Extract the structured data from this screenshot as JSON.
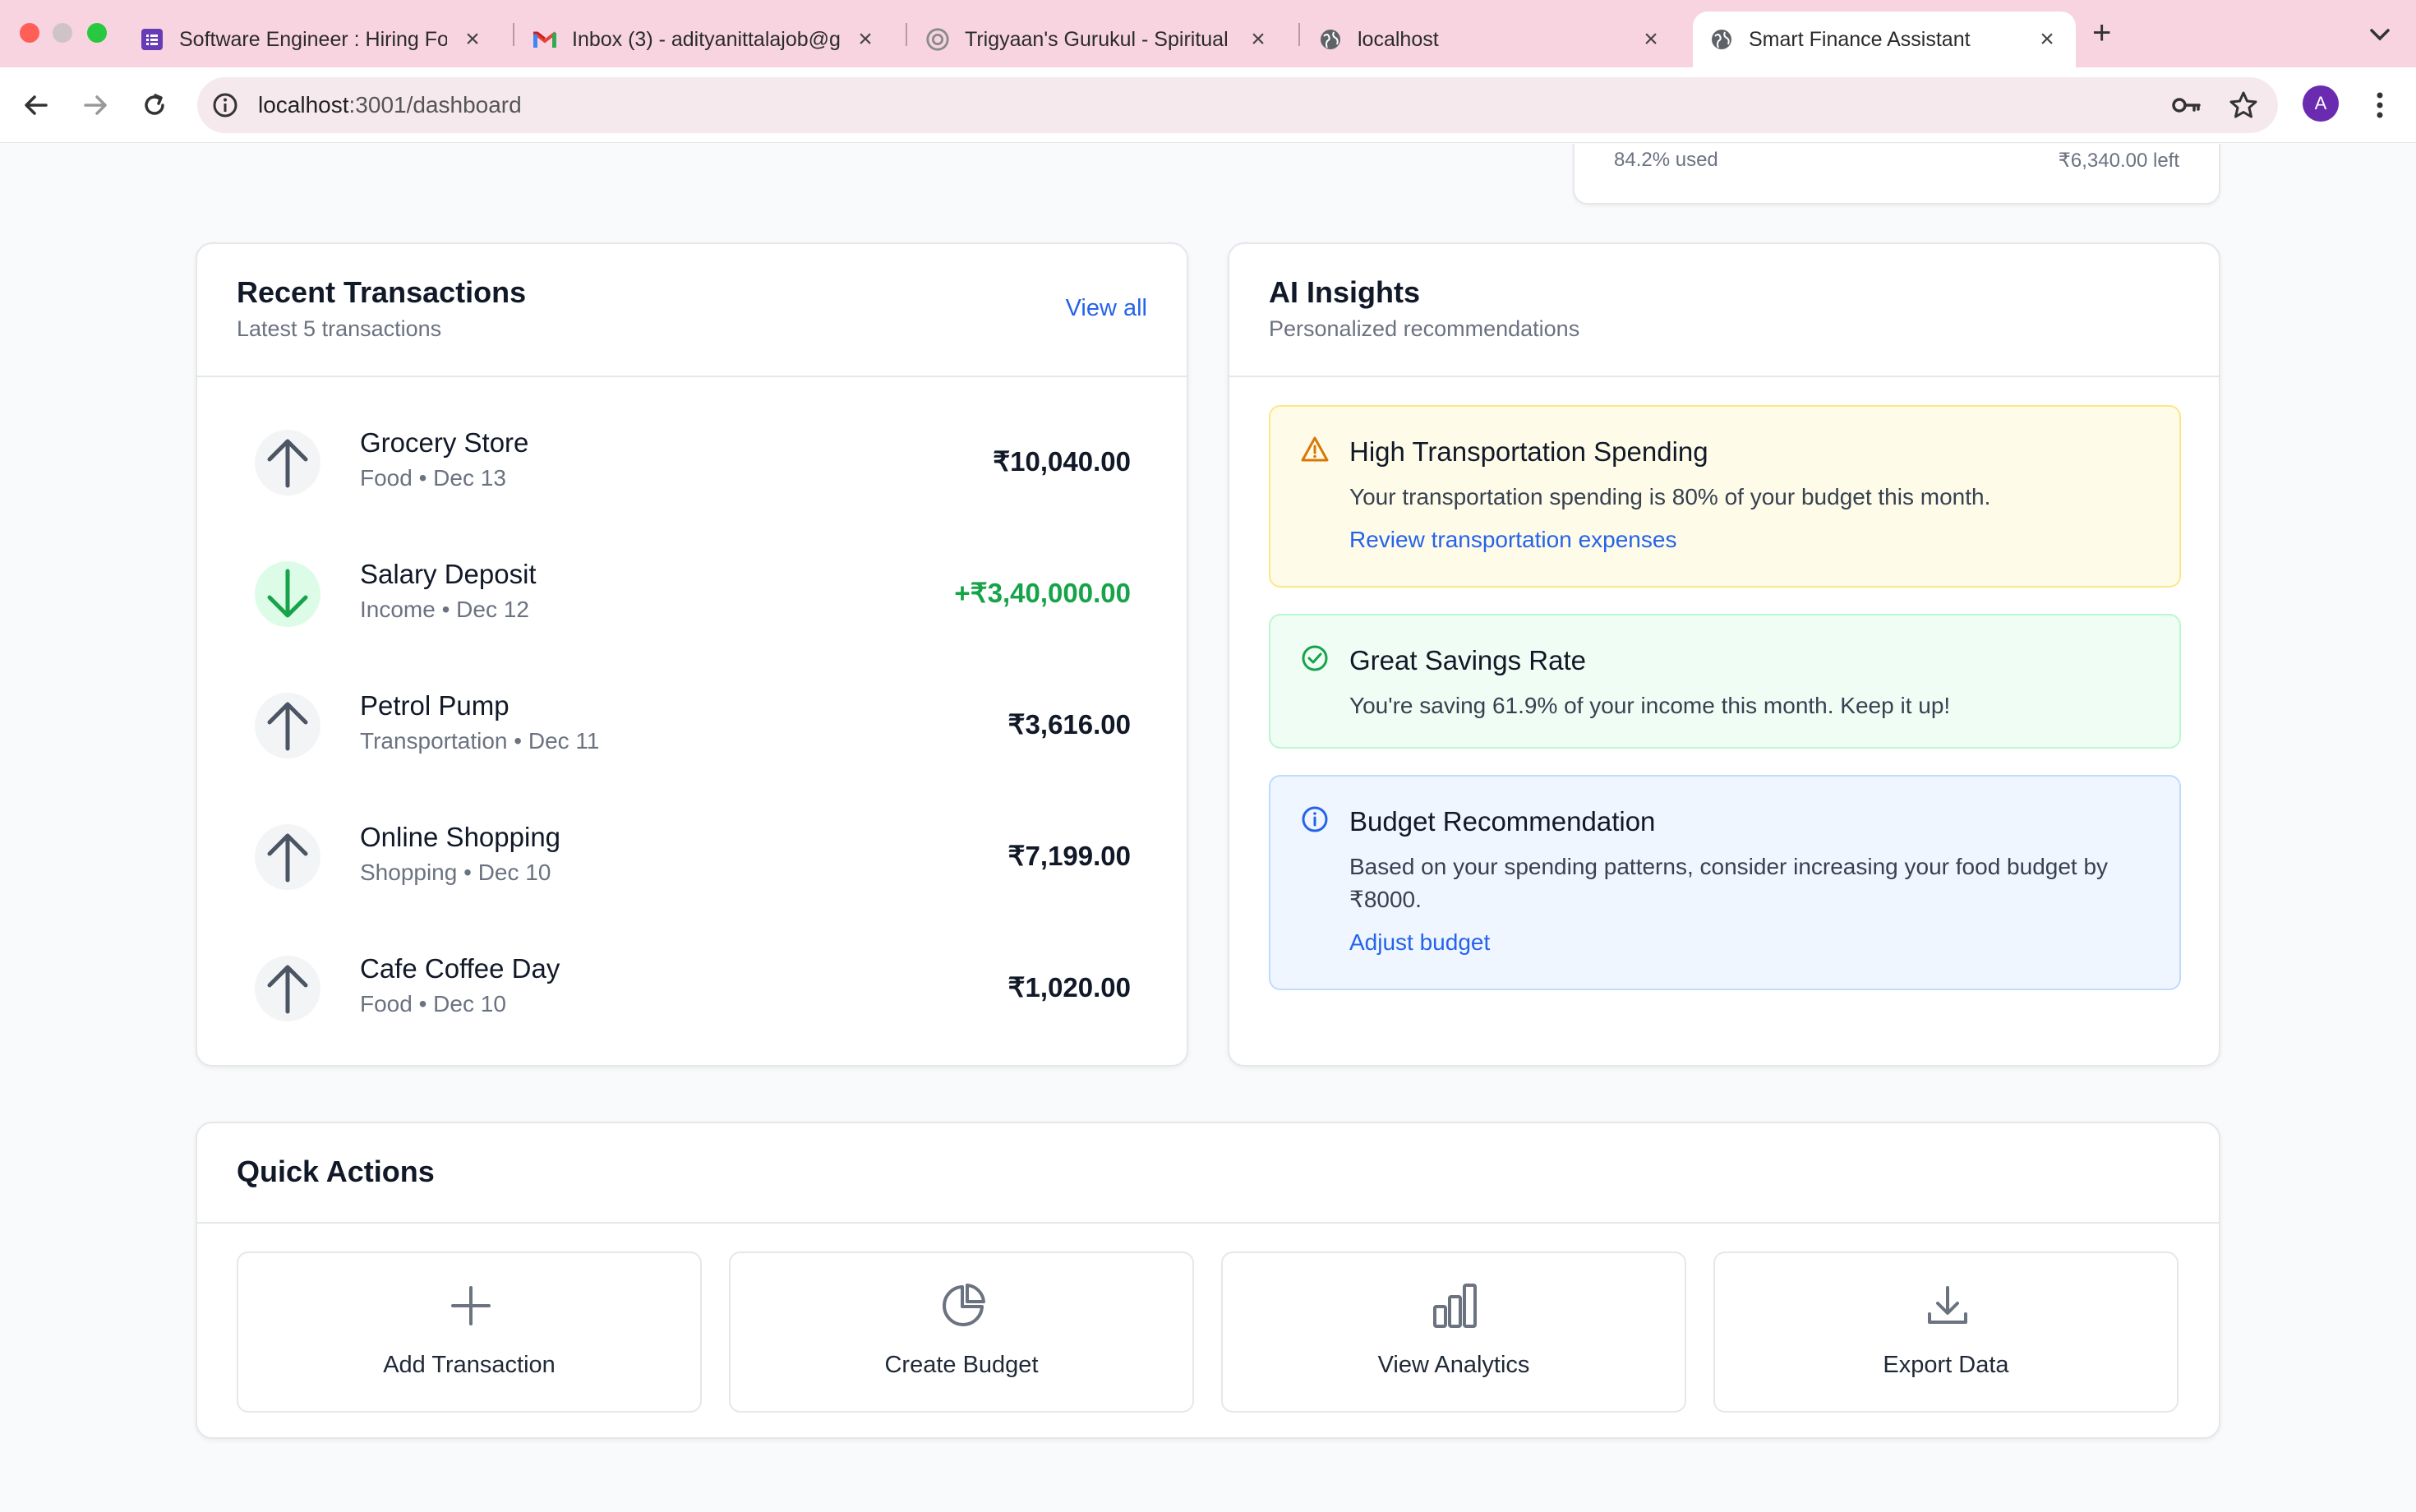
{
  "browser": {
    "tabs": [
      {
        "title": "Software Engineer : Hiring Fo",
        "favicon": "forms-icon",
        "active": false
      },
      {
        "title": "Inbox (3) - adityanittalajob@g",
        "favicon": "gmail-icon",
        "active": false
      },
      {
        "title": "Trigyaan's Gurukul - Spiritual",
        "favicon": "gurukul-icon",
        "active": false
      },
      {
        "title": "localhost",
        "favicon": "globe-icon",
        "active": false
      },
      {
        "title": "Smart Finance Assistant",
        "favicon": "globe-icon",
        "active": true
      }
    ],
    "new_tab_label": "+",
    "url_host": "localhost",
    "url_path": ":3001/dashboard",
    "avatar_initial": "A"
  },
  "budget_remnant": {
    "used_text": "84.2% used",
    "left_text": "₹6,340.00 left"
  },
  "transactions": {
    "title": "Recent Transactions",
    "subtitle": "Latest 5 transactions",
    "view_all": "View all",
    "items": [
      {
        "name": "Grocery Store",
        "meta": "Food • Dec 13",
        "amount": "₹10,040.00",
        "direction": "out"
      },
      {
        "name": "Salary Deposit",
        "meta": "Income • Dec 12",
        "amount": "+₹3,40,000.00",
        "direction": "in"
      },
      {
        "name": "Petrol Pump",
        "meta": "Transportation • Dec 11",
        "amount": "₹3,616.00",
        "direction": "out"
      },
      {
        "name": "Online Shopping",
        "meta": "Shopping • Dec 10",
        "amount": "₹7,199.00",
        "direction": "out"
      },
      {
        "name": "Cafe Coffee Day",
        "meta": "Food • Dec 10",
        "amount": "₹1,020.00",
        "direction": "out"
      }
    ]
  },
  "insights": {
    "title": "AI Insights",
    "subtitle": "Personalized recommendations",
    "items": [
      {
        "title": "High Transportation Spending",
        "body": "Your transportation spending is 80% of your budget this month.",
        "link": "Review transportation expenses",
        "kind": "warning"
      },
      {
        "title": "Great Savings Rate",
        "body": "You're saving 61.9% of your income this month. Keep it up!",
        "link": "",
        "kind": "success"
      },
      {
        "title": "Budget Recommendation",
        "body": "Based on your spending patterns, consider increasing your food budget by ₹8000.",
        "link": "Adjust budget",
        "kind": "info"
      }
    ]
  },
  "quick_actions": {
    "title": "Quick Actions",
    "items": [
      {
        "label": "Add Transaction",
        "icon": "plus-icon"
      },
      {
        "label": "Create Budget",
        "icon": "pie-chart-icon"
      },
      {
        "label": "View Analytics",
        "icon": "bar-chart-icon"
      },
      {
        "label": "Export Data",
        "icon": "download-icon"
      }
    ]
  },
  "colors": {
    "accent": "#2563eb",
    "income": "#16a34a",
    "warning": "#d97706",
    "success": "#16a34a",
    "info": "#2563eb",
    "tab_strip": "#f7d4df"
  }
}
